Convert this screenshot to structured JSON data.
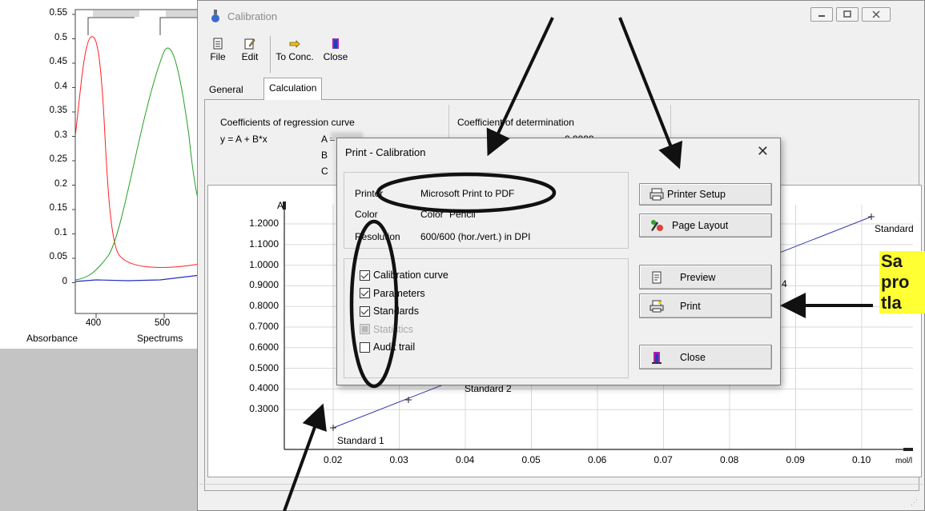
{
  "spectrum_window": {
    "y_ticks": [
      "0.55",
      "0.5",
      "0.45",
      "0.4",
      "0.35",
      "0.3",
      "0.25",
      "0.2",
      "0.15",
      "0.1",
      "0.05",
      "0"
    ],
    "x_ticks": [
      "400",
      "500"
    ],
    "tab_absorbance": "Absorbance",
    "tab_spectrums": "Spectrums"
  },
  "calibration_window": {
    "title": "Calibration",
    "toolbar": [
      {
        "label": "File",
        "icon": "file-icon"
      },
      {
        "label": "Edit",
        "icon": "edit-icon"
      },
      {
        "label": "To Conc.",
        "icon": "pointing-hand-icon"
      },
      {
        "label": "Close",
        "icon": "door-close-icon"
      }
    ],
    "tabs": [
      {
        "label": "General"
      },
      {
        "label": "Calculation"
      }
    ],
    "coefficients_title": "Coefficients of regression curve",
    "equation": "y = A + B*x",
    "coef_a": "A =",
    "coef_b": "B",
    "coef_c": "C",
    "determination_title": "Coefficient of determination",
    "determination_value": "0.9999",
    "plot": {
      "y_axis_label": "A",
      "x_axis_label": "mol/l",
      "y_ticks": [
        "1.2000",
        "1.1000",
        "1.0000",
        "0.9000",
        "0.8000",
        "0.7000",
        "0.6000",
        "0.5000",
        "0.4000",
        "0.3000"
      ],
      "x_ticks": [
        "0.02",
        "0.03",
        "0.04",
        "0.05",
        "0.06",
        "0.07",
        "0.08",
        "0.09",
        "0.10"
      ],
      "labels": {
        "standard_1": "Standard 1",
        "standard_2": "Standard 2",
        "standard_4": "4",
        "standard_end": "Standard"
      }
    }
  },
  "print_dialog": {
    "title": "Print - Calibration",
    "close_glyph": "✕",
    "printer_label": "Printer",
    "printer_value": "Microsoft Print to PDF",
    "color_label": "Color",
    "color_value": "Color",
    "color_extra": "Pencil",
    "resolution_label": "Resolution",
    "resolution_value": "600/600 (hor./vert.) in DPI",
    "options": [
      {
        "label": "Calibration curve",
        "checked": true,
        "enabled": true
      },
      {
        "label": "Parameters",
        "checked": true,
        "enabled": true
      },
      {
        "label": "Standards",
        "checked": true,
        "enabled": true
      },
      {
        "label": "Statistics",
        "checked": false,
        "enabled": false
      },
      {
        "label": "Audit trail",
        "checked": false,
        "enabled": true
      }
    ],
    "buttons": {
      "printer_setup": "Printer Setup",
      "page_layout": "Page Layout",
      "preview": "Preview",
      "print": "Print",
      "close": "Close"
    }
  },
  "annotation": {
    "lines": [
      "Sa",
      "pro",
      "tla"
    ]
  },
  "colors": {
    "banner": "#ffff33",
    "red_curve": "#ff2020",
    "green_curve": "#20a020",
    "blue_curve": "#2030c0",
    "calibration_line": "#3838a8"
  }
}
